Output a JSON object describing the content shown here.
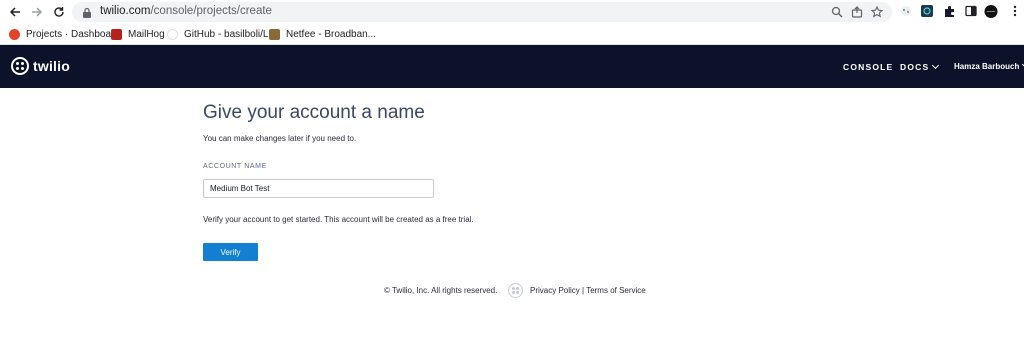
{
  "browser": {
    "url_host": "twilio.com",
    "url_path": "/console/projects/create",
    "bookmarks": [
      {
        "label": "Projects · Dashboar...",
        "icon": "gitlab-icon",
        "color": "#e24329"
      },
      {
        "label": "MailHog",
        "icon": "mailhog-icon",
        "color": "#b5241c"
      },
      {
        "label": "GitHub - basilboli/L...",
        "icon": "github-icon",
        "color": "#dddddd"
      },
      {
        "label": "Netfee - Broadban...",
        "icon": "netfee-icon",
        "color": "#8a6a3a"
      }
    ]
  },
  "nav": {
    "brand": "twilio",
    "console": "CONSOLE",
    "docs": "DOCS",
    "user": "Hamza Barbouch"
  },
  "form": {
    "heading": "Give your account a name",
    "subtext": "You can make changes later if you need to.",
    "account_name_label": "ACCOUNT NAME",
    "account_name_value": "Medium Bot Test",
    "verify_note": "Verify your account to get started. This account will be created as a free trial.",
    "verify_button": "Verify"
  },
  "footer": {
    "copyright": "© Twilio, Inc. All rights reserved.",
    "privacy": "Privacy Policy",
    "separator": "|",
    "terms": "Terms of Service"
  },
  "colors": {
    "nav_bg": "#0d122b",
    "primary_button": "#127fd1"
  }
}
